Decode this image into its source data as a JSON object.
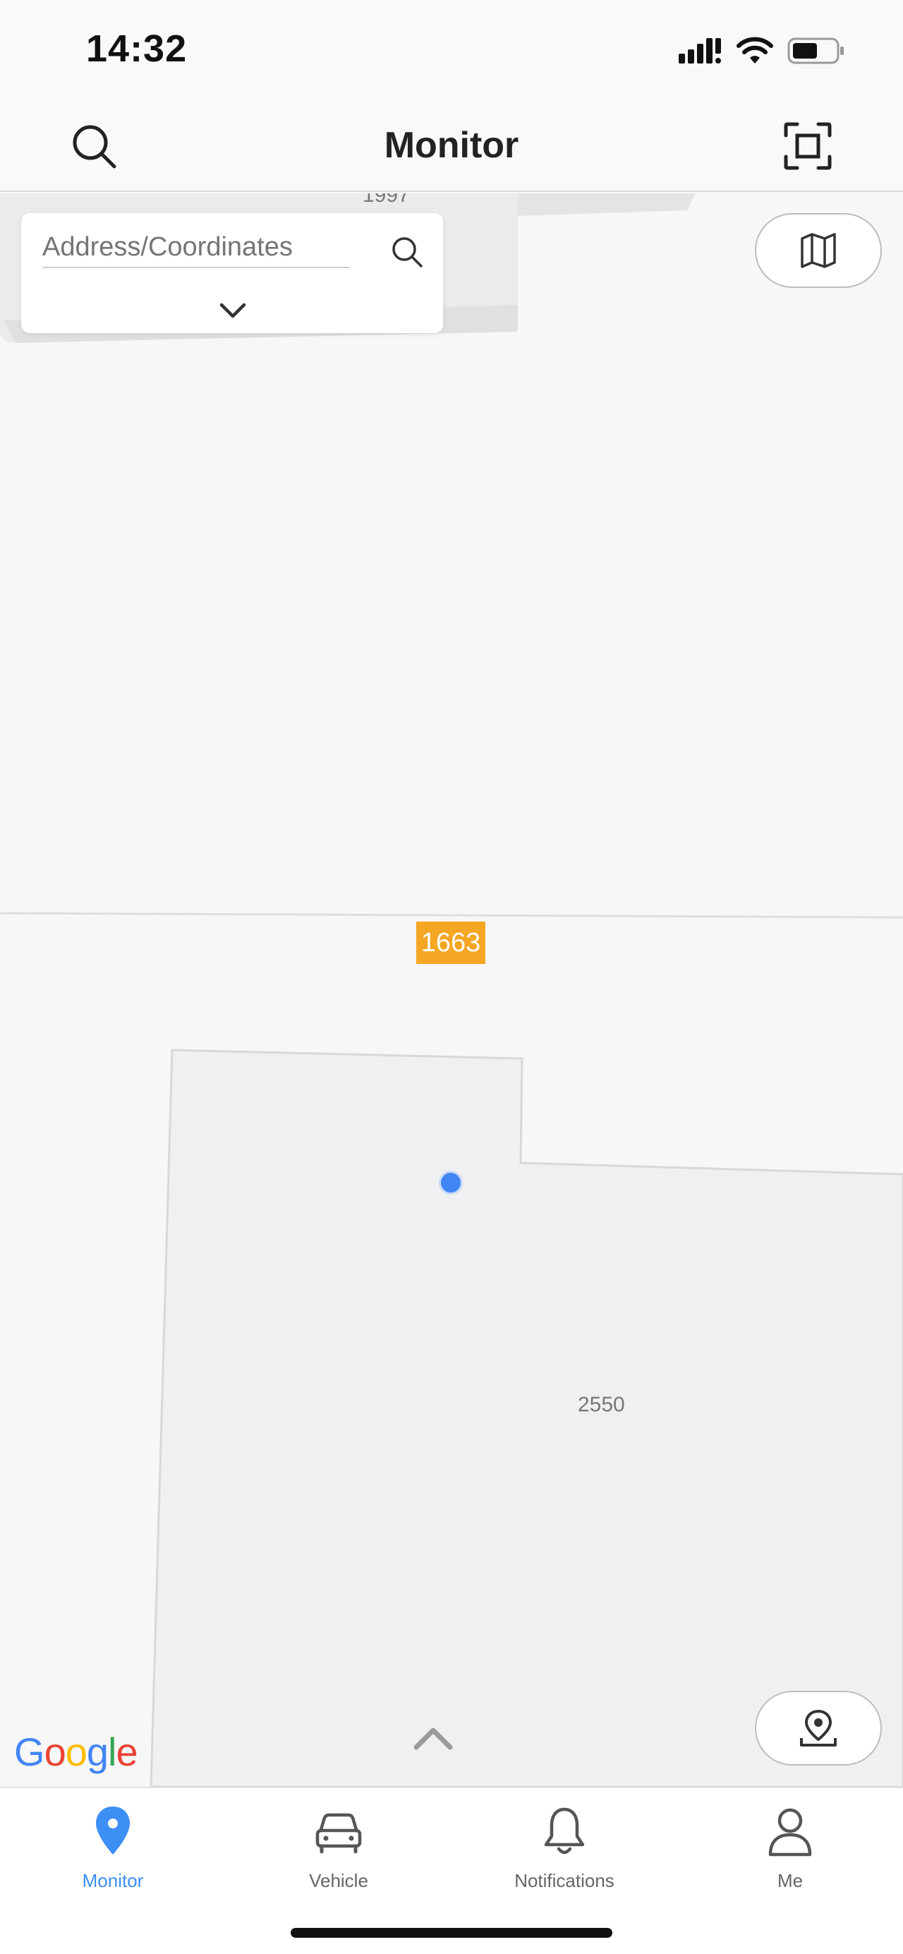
{
  "status_bar": {
    "time": "14:32",
    "icons": [
      "cellular-signal-icon",
      "wifi-icon",
      "battery-icon"
    ]
  },
  "header": {
    "title": "Monitor",
    "left_icon": "search-icon",
    "right_icon": "scan-icon"
  },
  "search": {
    "placeholder": "Address/Coordinates",
    "search_icon": "search-icon",
    "expand_icon": "chevron-down-icon"
  },
  "map": {
    "labels": [
      "1997",
      "1663",
      "2550"
    ],
    "marker_label": "1663",
    "marker_color": "#f5a623",
    "location_dot_color": "#4285f4",
    "map_type_icon": "map-icon",
    "locate_icon": "location-pin-icon",
    "expand_icon": "chevron-up-icon",
    "attribution": [
      "G",
      "o",
      "o",
      "g",
      "l",
      "e"
    ],
    "attribution_colors": [
      "#4285f4",
      "#ea4335",
      "#fbbc05",
      "#4285f4",
      "#34a853",
      "#ea4335"
    ]
  },
  "tabs": [
    {
      "label": "Monitor",
      "icon": "location-pin-icon",
      "active": true
    },
    {
      "label": "Vehicle",
      "icon": "car-icon",
      "active": false
    },
    {
      "label": "Notifications",
      "icon": "bell-icon",
      "active": false
    },
    {
      "label": "Me",
      "icon": "person-icon",
      "active": false
    }
  ],
  "colors": {
    "accent": "#3d8ef5",
    "tab_inactive": "#666666"
  }
}
